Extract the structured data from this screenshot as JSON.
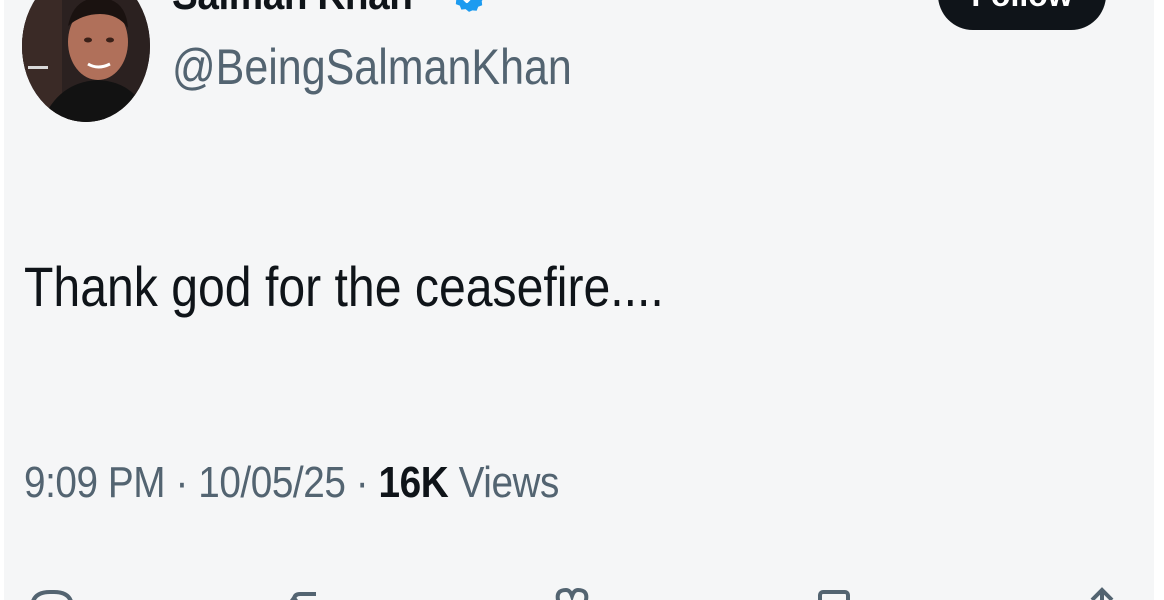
{
  "tweet": {
    "display_name": "Salman Khan",
    "handle": "@BeingSalmanKhan",
    "follow_label": "Follow",
    "text": "Thank god for the ceasefire....",
    "time": "9:09 PM",
    "separator": "·",
    "date": "10/05/25",
    "views_count": "16K",
    "views_label": "Views"
  },
  "icons": {
    "verified": "verified-badge-icon",
    "reply": "reply-icon",
    "retweet": "retweet-icon",
    "like": "like-icon",
    "bookmark": "bookmark-icon",
    "share": "share-icon"
  },
  "colors": {
    "background": "#f5f6f7",
    "text_primary": "#0f1419",
    "text_secondary": "#536471",
    "verified_blue": "#1d9bf0",
    "button_dark": "#0f1419"
  }
}
